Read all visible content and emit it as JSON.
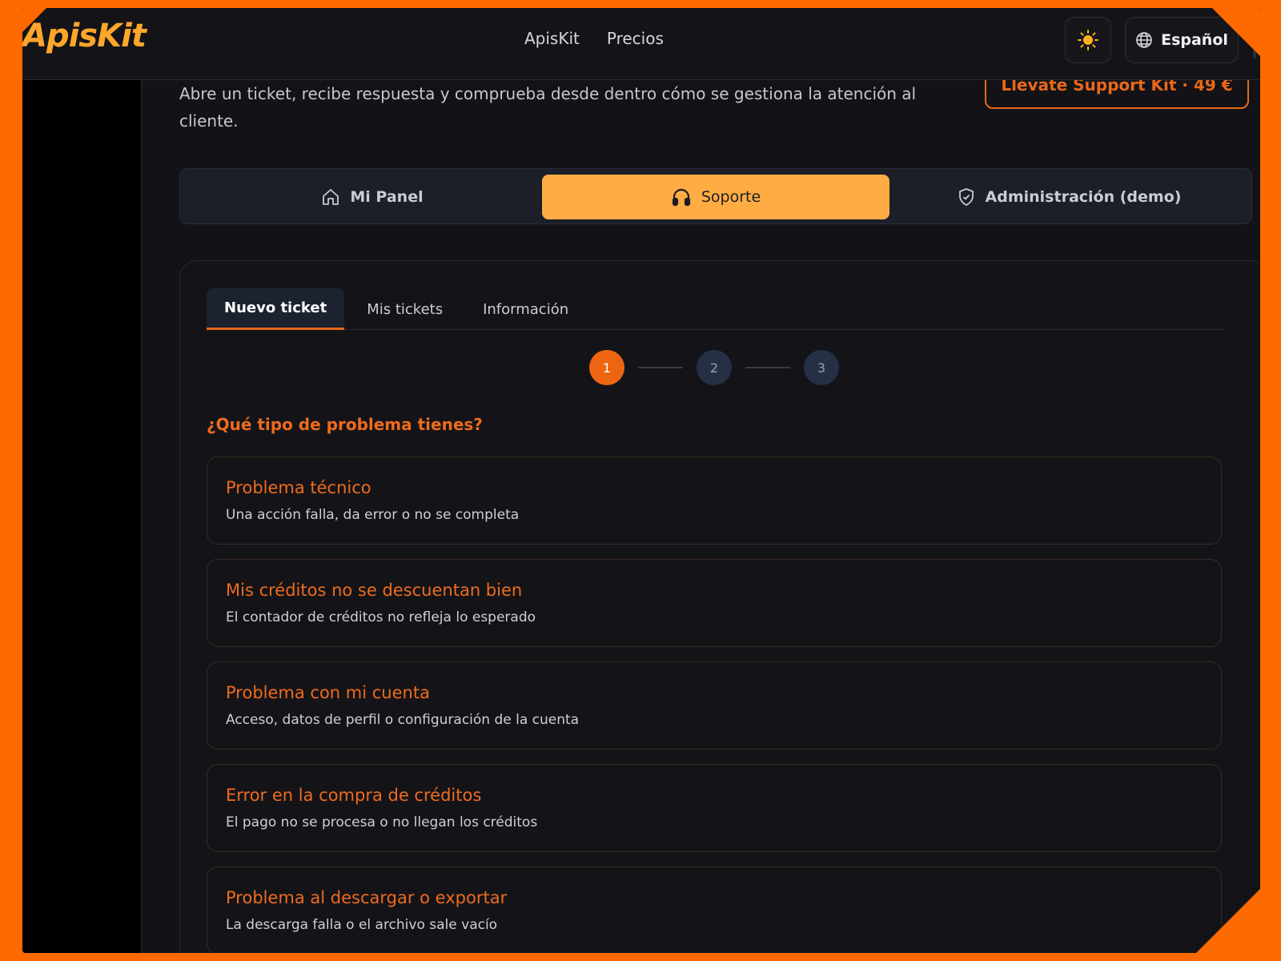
{
  "header": {
    "logo_text": "ApisKit",
    "nav": [
      "ApisKit",
      "Precios"
    ],
    "theme_icon": "sun-icon",
    "language_label": "Español",
    "language_icon": "globe-icon"
  },
  "intro": {
    "text": "Abre un ticket, recibe respuesta y comprueba desde dentro cómo se gestiona la atención al cliente.",
    "upgrade_label": "Llévate Support Kit · 49 €"
  },
  "section_tabs": [
    {
      "label": "Mi Panel",
      "icon": "home-icon",
      "active": false
    },
    {
      "label": "Soporte",
      "icon": "headphones-icon",
      "active": true
    },
    {
      "label": "Administración (demo)",
      "icon": "shield-check-icon",
      "active": false
    }
  ],
  "ticket_tabs": [
    {
      "label": "Nuevo ticket",
      "active": true
    },
    {
      "label": "Mis tickets",
      "active": false
    },
    {
      "label": "Información",
      "active": false
    }
  ],
  "stepper": {
    "steps": [
      "1",
      "2",
      "3"
    ],
    "current": 1
  },
  "question": "¿Qué tipo de problema tienes?",
  "options": [
    {
      "title": "Problema técnico",
      "description": "Una acción falla, da error o no se completa"
    },
    {
      "title": "Mis créditos no se descuentan bien",
      "description": "El contador de créditos no refleja lo esperado"
    },
    {
      "title": "Problema con mi cuenta",
      "description": "Acceso, datos de perfil o configuración de la cuenta"
    },
    {
      "title": "Error en la compra de créditos",
      "description": "El pago no se procesa o no llegan los créditos"
    },
    {
      "title": "Problema al descargar o exportar",
      "description": "La descarga falla o el archivo sale vacío"
    }
  ],
  "colors": {
    "accent": "#ee6b1e",
    "active_tab": "#ffac45",
    "background": "#131317",
    "frame": "#ff6a00"
  }
}
